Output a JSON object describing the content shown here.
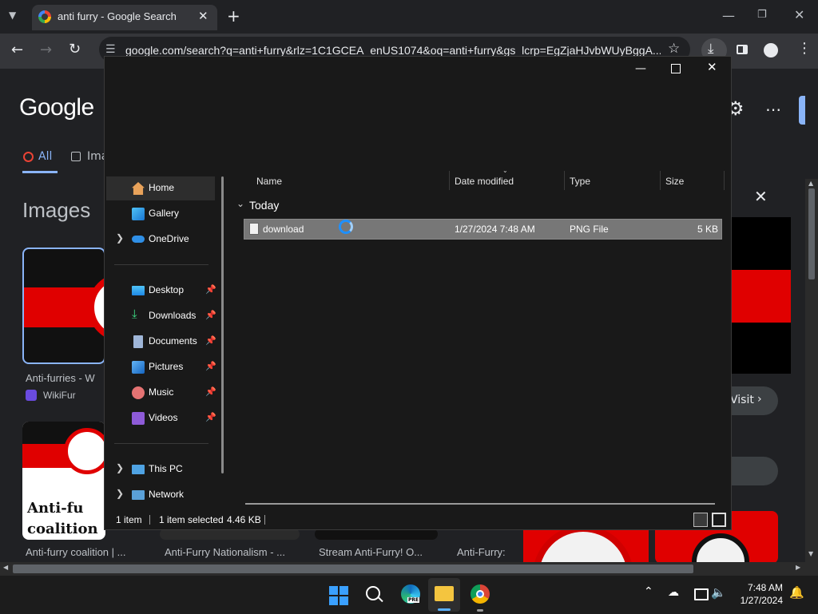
{
  "browser": {
    "tab_title": "anti furry - Google Search",
    "url": "google.com/search?q=anti+furry&rlz=1C1GCEA_enUS1074&oq=anti+furry&gs_lcrp=EgZjaHJvbWUyBggA..."
  },
  "google": {
    "logo": "Google",
    "tab_all": "All",
    "tab_images_partial": "Ima",
    "images_heading": "Images",
    "results": [
      {
        "caption": "Anti-furries - W",
        "source": "WikiFur"
      },
      {
        "caption": "Anti-furry coalition | ...",
        "thumb_text": "Anti-fu coalition"
      },
      {
        "caption": "Anti-Furry Nationalism - ..."
      },
      {
        "caption": "Stream Anti-Furry! O..."
      },
      {
        "caption": "Anti-Furry:"
      }
    ],
    "visit_label": "Visit"
  },
  "explorer": {
    "nav": {
      "home": "Home",
      "gallery": "Gallery",
      "onedrive": "OneDrive",
      "desktop": "Desktop",
      "downloads": "Downloads",
      "documents": "Documents",
      "pictures": "Pictures",
      "music": "Music",
      "videos": "Videos",
      "this_pc": "This PC",
      "network": "Network"
    },
    "columns": {
      "name": "Name",
      "date": "Date modified",
      "type": "Type",
      "size": "Size"
    },
    "group": "Today",
    "file": {
      "name": "download",
      "date": "1/27/2024 7:48 AM",
      "type": "PNG File",
      "size": "5 KB"
    },
    "status": {
      "count": "1 item",
      "selected": "1 item selected",
      "size": "4.46 KB"
    }
  },
  "taskbar": {
    "time": "7:48 AM",
    "date": "1/27/2024",
    "edge_badge": "PRE"
  },
  "colors": {
    "accent": "#8ab4f8",
    "selection": "#777777",
    "flag_red": "#e00000"
  }
}
